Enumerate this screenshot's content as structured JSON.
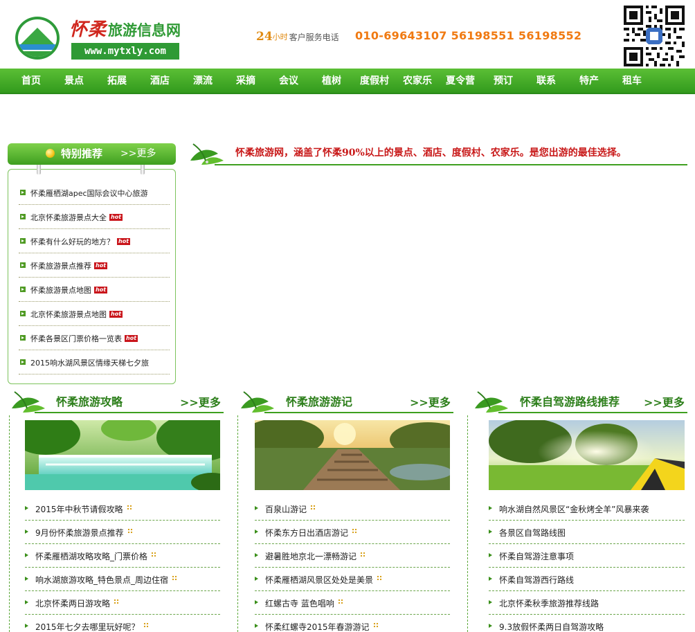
{
  "header": {
    "logo_title_a": "怀柔",
    "logo_title_b": "旅游信息网",
    "logo_url": "www.mytxly.com",
    "hotline_24": "24",
    "hotline_hours": "小时",
    "hotline_label": "客户服务电话",
    "phones": "010-69643107  56198551  56198552"
  },
  "nav": [
    "首页",
    "景点",
    "拓展",
    "酒店",
    "漂流",
    "采摘",
    "会议",
    "植树",
    "度假村",
    "农家乐",
    "夏令营",
    "预订",
    "联系",
    "特产",
    "租车"
  ],
  "recommend": {
    "title": "特别推荐",
    "more": ">>更多",
    "hot_label": "hot",
    "items": [
      {
        "text": "怀柔雁栖湖apec国际会议中心旅游",
        "hot": false
      },
      {
        "text": "北京怀柔旅游景点大全",
        "hot": true
      },
      {
        "text": "怀柔有什么好玩的地方？",
        "hot": true
      },
      {
        "text": "怀柔旅游景点推荐",
        "hot": true
      },
      {
        "text": "怀柔旅游景点地图",
        "hot": true
      },
      {
        "text": "北京怀柔旅游景点地图",
        "hot": true
      },
      {
        "text": "怀柔各景区门票价格一览表",
        "hot": true
      },
      {
        "text": "2015响水湖风景区情缘天梯七夕旅",
        "hot": false
      }
    ]
  },
  "slogan": "怀柔旅游网，涵盖了怀柔90%以上的景点、酒店、度假村、农家乐。是您出游的最佳选择。",
  "columns": [
    {
      "title": "怀柔旅游攻略",
      "more": ">>更多",
      "items": [
        "2015年中秋节请假攻略",
        "9月份怀柔旅游景点推荐",
        "怀柔雁栖湖攻略攻略_门票价格",
        "响水湖旅游攻略_特色景点_周边住宿",
        "北京怀柔两日游攻略",
        "2015年七夕去哪里玩好呢？"
      ]
    },
    {
      "title": "怀柔旅游游记",
      "more": ">>更多",
      "items": [
        "百泉山游记",
        "怀柔东方日出酒店游记",
        "避暑胜地京北一漂畅游记",
        "怀柔雁栖湖风景区处处是美景",
        "红螺古寺  蓝色唱响",
        "怀柔红螺寺2015年春游游记"
      ]
    },
    {
      "title": "怀柔自驾游路线推荐",
      "more": ">>更多",
      "items": [
        "响水湖自然风景区“金秋烤全羊”风暴来袭",
        "各景区自驾路线图",
        "怀柔自驾游注意事项",
        "怀柔自驾游西行路线",
        "北京怀柔秋季旅游推荐线路",
        "9.3放假怀柔两日自驾游攻略"
      ]
    }
  ],
  "colors": {
    "nav_green": "#3ea523",
    "brand_red": "#c81818",
    "phone_orange": "#f07a12",
    "title_green": "#2d7f1b"
  }
}
